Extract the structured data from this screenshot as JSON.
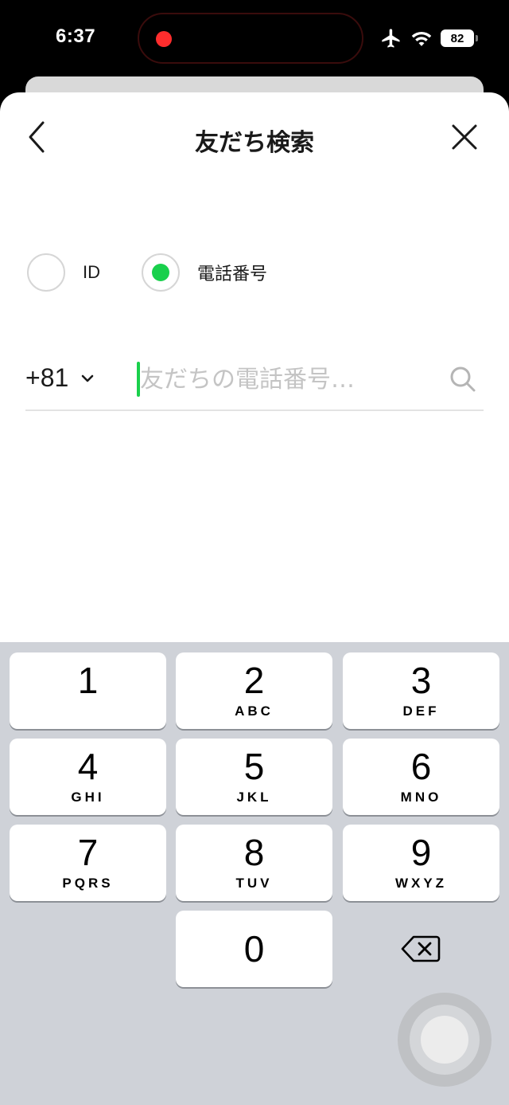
{
  "status_bar": {
    "time": "6:37",
    "battery": "82",
    "icons": [
      "airplane-icon",
      "wifi-icon",
      "battery-icon"
    ],
    "recording_color": "#ff2d2d"
  },
  "header": {
    "title": "友だち検索",
    "back_icon": "chevron-left-icon",
    "close_icon": "close-icon"
  },
  "search_type": {
    "options": [
      {
        "label": "ID",
        "selected": false
      },
      {
        "label": "電話番号",
        "selected": true
      }
    ]
  },
  "phone_search": {
    "country_code": "+81",
    "placeholder": "友だちの電話番号…",
    "value": "",
    "search_icon": "search-icon"
  },
  "accent_color": "#19d04c",
  "keypad": {
    "keys": [
      {
        "num": "1",
        "letters": ""
      },
      {
        "num": "2",
        "letters": "ABC"
      },
      {
        "num": "3",
        "letters": "DEF"
      },
      {
        "num": "4",
        "letters": "GHI"
      },
      {
        "num": "5",
        "letters": "JKL"
      },
      {
        "num": "6",
        "letters": "MNO"
      },
      {
        "num": "7",
        "letters": "PQRS"
      },
      {
        "num": "8",
        "letters": "TUV"
      },
      {
        "num": "9",
        "letters": "WXYZ"
      },
      {
        "num": "0",
        "letters": ""
      }
    ],
    "backspace_icon": "backspace-icon"
  }
}
